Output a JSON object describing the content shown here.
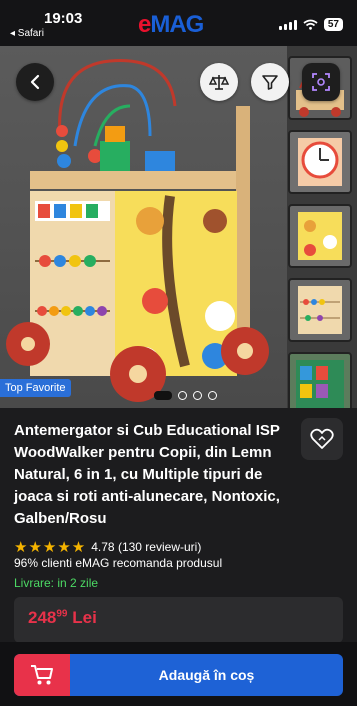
{
  "status_bar": {
    "time": "19:03",
    "back_app": "◂ Safari",
    "battery": "57"
  },
  "brand": {
    "logo_e": "e",
    "logo_rest": "MAG",
    "colors": {
      "red": "#e8112d",
      "blue": "#1a5fd6"
    }
  },
  "gallery": {
    "badge": "Top Favorite",
    "image_count": 4,
    "active_index": 0,
    "thumbnails": 5,
    "icons": [
      "back-arrow-icon",
      "compare-icon",
      "filter-icon",
      "visual-search-icon"
    ]
  },
  "product": {
    "title": "Antemergator si Cub Educational ISP WoodWalker pentru Copii, din Lemn Natural, 6 in 1, cu Multiple tipuri de joaca si roti anti-alunecare, Nontoxic, Galben/Rosu",
    "rating_value": "4.78",
    "rating_stars": 5,
    "reviews": "(130 review-uri)",
    "recommendation": "96% clienti eMAG recomanda produsul",
    "delivery": "Livrare: in 2 zile",
    "price_int": "248",
    "price_dec": "99",
    "currency": "Lei"
  },
  "cart": {
    "label": "Adaugă în coș",
    "icon": "cart-icon"
  }
}
